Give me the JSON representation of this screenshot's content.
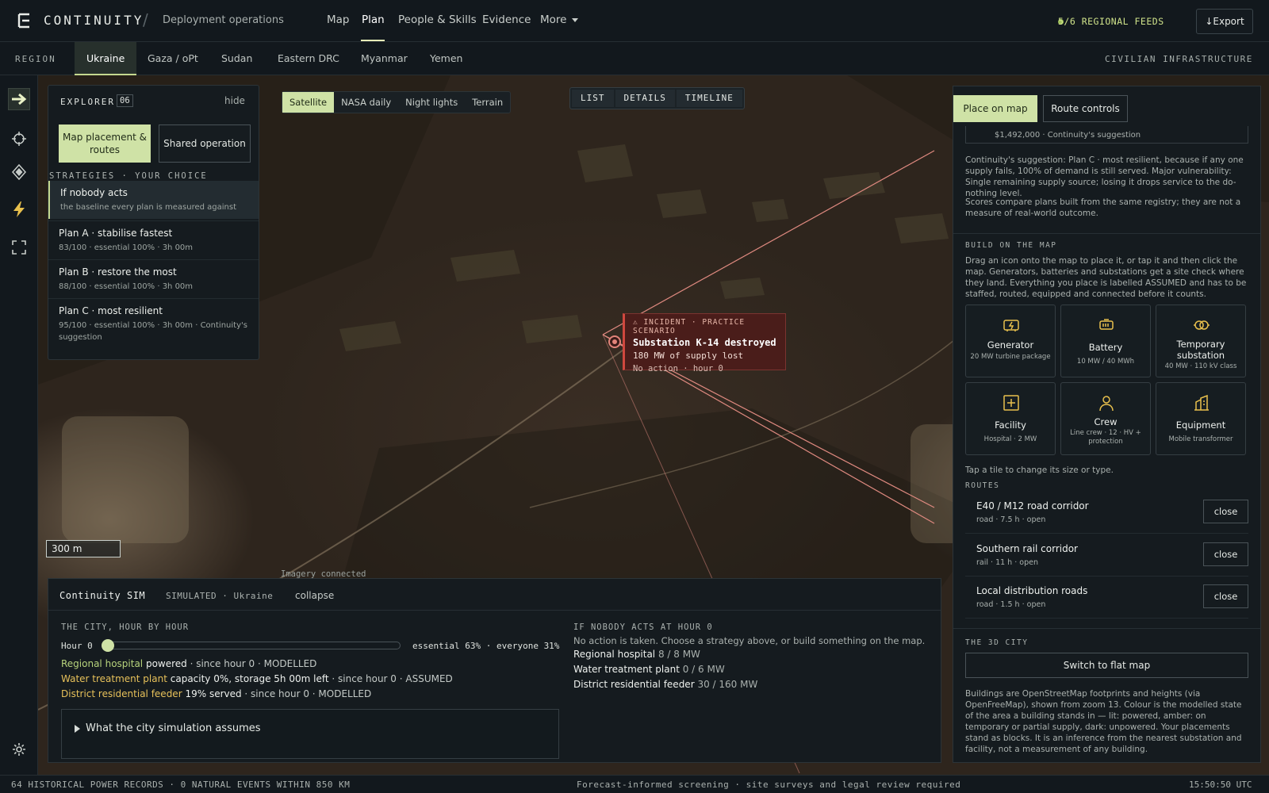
{
  "topbar": {
    "brand": "CONTINUITY",
    "separator": "/",
    "subtitle": "Deployment operations",
    "nav": [
      "Map",
      "Plan",
      "People & Skills",
      "Evidence",
      "More"
    ],
    "active_nav": "Plan",
    "feeds": "5/6 REGIONAL FEEDS",
    "export_label": "↓Export"
  },
  "regionbar": {
    "label": "REGION",
    "regions": [
      "Ukraine",
      "Gaza / oPt",
      "Sudan",
      "Eastern DRC",
      "Myanmar",
      "Yemen"
    ],
    "active_region": "Ukraine",
    "layer_label": "CIVILIAN INFRASTRUCTURE"
  },
  "map": {
    "imagery_options": [
      "Satellite",
      "NASA daily",
      "Night lights",
      "Terrain"
    ],
    "active_imagery": "Satellite",
    "views": [
      "LIST",
      "DETAILS",
      "TIMELINE"
    ],
    "scale": "300 m",
    "imagery_status": "Imagery connected",
    "incident": {
      "tag": "⚠ INCIDENT · PRACTICE SCENARIO",
      "title": "Substation K-14 destroyed",
      "subtitle": "180 MW of supply lost",
      "meta": "No action · hour 0"
    }
  },
  "explorer": {
    "title": "EXPLORER",
    "count": "06",
    "hide_label": "hide",
    "mode_map": "Map placement & routes",
    "mode_shared": "Shared operation",
    "strategies_header": "STRATEGIES · YOUR CHOICE",
    "strategies": [
      {
        "name": "If nobody acts",
        "meta": "the baseline every plan is measured against"
      },
      {
        "name": "Plan A · stabilise fastest",
        "meta": "83/100 · essential 100% · 3h 00m"
      },
      {
        "name": "Plan B · restore the most",
        "meta": "88/100 · essential 100% · 3h 00m"
      },
      {
        "name": "Plan C · most resilient",
        "meta": "95/100 · essential 100% · 3h 00m · Continuity's suggestion"
      }
    ]
  },
  "sim": {
    "title": "Continuity SIM",
    "mode": "SIMULATED · Ukraine",
    "collapse_label": "collapse",
    "city_header": "THE CITY, HOUR BY HOUR",
    "hour_label": "Hour 0",
    "hour_value": 0,
    "essential": "essential 63% · everyone 31%",
    "lines": [
      {
        "name": "Regional hospital",
        "state": "powered",
        "rest": " · since hour 0 · MODELLED"
      },
      {
        "name": "Water treatment plant",
        "state": "capacity 0%, storage 5h 00m left",
        "rest": " · since hour 0 · ASSUMED"
      },
      {
        "name": "District residential feeder",
        "state": "19% served",
        "rest": " · since hour 0 · MODELLED"
      }
    ],
    "assumptions_label": "What the city simulation assumes",
    "nobody_header": "IF NOBODY ACTS AT HOUR 0",
    "nobody_note": "No action is taken. Choose a strategy above, or build something on the map.",
    "nobody_lines": [
      {
        "name": "Regional hospital",
        "value": " 8 / 8 MW"
      },
      {
        "name": "Water treatment plant",
        "value": " 0 / 6 MW"
      },
      {
        "name": "District residential feeder",
        "value": " 30 / 160 MW"
      }
    ]
  },
  "right": {
    "tab_place": "Place on map",
    "tab_route": "Route controls",
    "suggestion_cost": "$1,492,000 · Continuity's suggestion",
    "suggestion_text": "Continuity's suggestion: Plan C · most resilient, because if any one supply fails, 100% of demand is still served. Major vulnerability: Single remaining supply source; losing it drops service to the do-nothing level.",
    "scores_text": "Scores compare plans built from the same registry; they are not a measure of real-world outcome.",
    "build_header": "BUILD ON THE MAP",
    "build_text": "Drag an icon onto the map to place it, or tap it and then click the map. Generators, batteries and substations get a site check where they land. Everything you place is labelled ASSUMED and has to be staffed, routed, equipped and connected before it counts.",
    "tiles": [
      {
        "name": "Generator",
        "meta": "20 MW turbine package",
        "icon": "generator-icon"
      },
      {
        "name": "Battery",
        "meta": "10 MW / 40 MWh",
        "icon": "battery-icon"
      },
      {
        "name": "Temporary substation",
        "meta": "40 MW · 110 kV class",
        "icon": "substation-icon"
      },
      {
        "name": "Facility",
        "meta": "Hospital · 2 MW",
        "icon": "facility-icon"
      },
      {
        "name": "Crew",
        "meta": "Line crew · 12 · HV + protection",
        "icon": "crew-icon"
      },
      {
        "name": "Equipment",
        "meta": "Mobile transformer",
        "icon": "equipment-icon"
      }
    ],
    "tap_text": "Tap a tile to change its size or type.",
    "routes_header": "ROUTES",
    "routes": [
      {
        "name": "E40 / M12 road corridor",
        "meta": "road · 7.5 h · open",
        "action": "close"
      },
      {
        "name": "Southern rail corridor",
        "meta": "rail · 11 h · open",
        "action": "close"
      },
      {
        "name": "Local distribution roads",
        "meta": "road · 1.5 h · open",
        "action": "close"
      }
    ],
    "city_header": "THE 3D CITY",
    "switch_label": "Switch to flat map",
    "city_text": "Buildings are OpenStreetMap footprints and heights (via OpenFreeMap), shown from zoom 13. Colour is the modelled state of the area a building stands in — lit: powered, amber: on temporary or partial supply, dark: unpowered. Your placements stand as blocks. It is an inference from the nearest substation and facility, not a measurement of any building."
  },
  "statusbar": {
    "left": "64 HISTORICAL POWER RECORDS · 0 NATURAL EVENTS WITHIN 850 KM",
    "middle": "Forecast-informed screening · site surveys and legal review required",
    "time": "15:50:50 UTC"
  },
  "colors": {
    "accent": "#cfe2a6",
    "incident": "#d0483e",
    "powered": "#b7d37c",
    "assumed": "#e7c15a"
  }
}
